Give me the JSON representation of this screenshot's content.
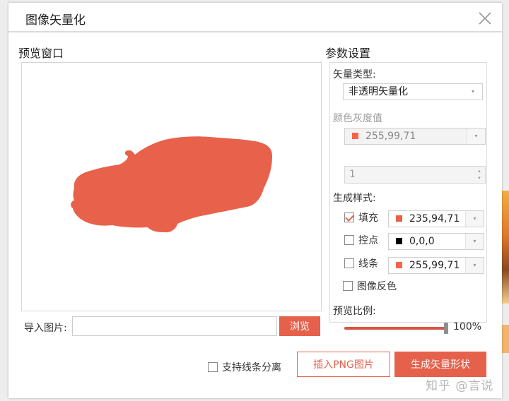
{
  "dialog": {
    "title": "图像矢量化",
    "close_icon": "close-icon"
  },
  "preview": {
    "heading": "预览窗口",
    "shape_color": "#e8614b",
    "shape_icon": "car-silhouette-image"
  },
  "import": {
    "label": "导入图片:",
    "value": "",
    "browse_label": "浏览"
  },
  "params": {
    "heading": "参数设置",
    "vector_type_label": "矢量类型:",
    "vector_type_value": "非透明矢量化",
    "color_gray_label": "颜色灰度值",
    "color_gray_value": "255,99,71",
    "color_gray_swatch": "#ff6347",
    "spin_value": "1",
    "style_label": "生成样式:",
    "styles": [
      {
        "label": "填充",
        "checked": true,
        "value": "235,94,71",
        "swatch": "#eb5e47"
      },
      {
        "label": "控点",
        "checked": false,
        "value": "0,0,0",
        "swatch": "#000000"
      },
      {
        "label": "线条",
        "checked": false,
        "value": "255,99,71",
        "swatch": "#ff6347"
      }
    ],
    "invert_label": "图像反色",
    "invert_checked": false,
    "preview_scale_label": "预览比例:",
    "preview_scale_value": "100%",
    "preview_scale_fraction": 1.0
  },
  "footer": {
    "separate_lines_label": "支持线条分离",
    "separate_lines_checked": false,
    "insert_png_label": "插入PNG图片",
    "generate_label": "生成矢量形状"
  },
  "watermark": "知乎 @言说",
  "colors": {
    "accent": "#e5614c"
  }
}
